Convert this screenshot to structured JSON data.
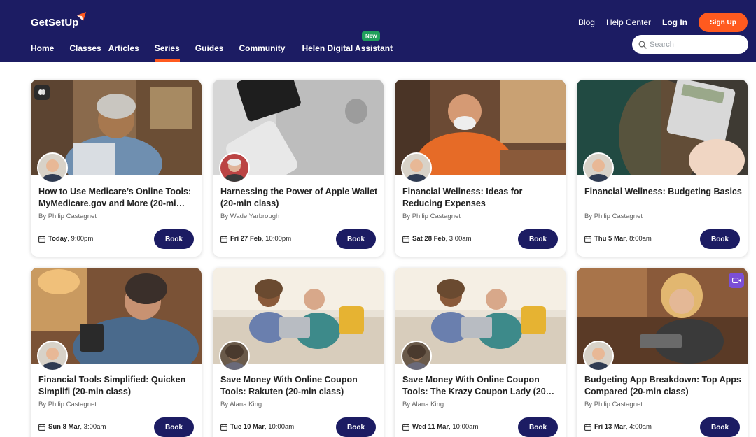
{
  "header": {
    "logo": "GetSetUp",
    "nav": [
      {
        "label": "Home"
      },
      {
        "label": "Classes"
      },
      {
        "label": "Articles"
      },
      {
        "label": "Series"
      },
      {
        "label": "Guides"
      },
      {
        "label": "Community"
      },
      {
        "label": "Helen Digital Assistant"
      }
    ],
    "active_nav": "Series",
    "new_badge": "New",
    "links": {
      "blog": "Blog",
      "help": "Help Center",
      "login": "Log In",
      "signup": "Sign Up"
    },
    "search_placeholder": "Search"
  },
  "colors": {
    "navy": "#1c1c63",
    "accent": "#ff5a1f",
    "new_badge": "#1f9f5b",
    "video_badge": "#7b4fd6"
  },
  "cards": [
    {
      "title": "How to Use Medicare’s Online Tools: MyMedicare.gov and More (20-mi…",
      "author": "By Philip Castagnet",
      "date_day": "Today",
      "date_time": ", 9:00pm",
      "book": "Book",
      "badge_icon": "brain-icon"
    },
    {
      "title": "Harnessing the Power of Apple Wallet (20-min class)",
      "author": "By Wade Yarbrough",
      "date_day": "Fri 27 Feb",
      "date_time": ", 10:00pm",
      "book": "Book"
    },
    {
      "title": "Financial Wellness: Ideas for Reducing Expenses",
      "author": "By Philip Castagnet",
      "date_day": "Sat 28 Feb",
      "date_time": ", 3:00am",
      "book": "Book"
    },
    {
      "title": "Financial Wellness: Budgeting Basics",
      "author": "By Philip Castagnet",
      "date_day": "Thu 5 Mar",
      "date_time": ", 8:00am",
      "book": "Book"
    },
    {
      "title": "Financial Tools Simplified: Quicken Simplifi (20-min class)",
      "author": "By Philip Castagnet",
      "date_day": "Sun 8 Mar",
      "date_time": ", 3:00am",
      "book": "Book"
    },
    {
      "title": "Save Money With Online Coupon Tools: Rakuten (20-min class)",
      "author": "By Alana King",
      "date_day": "Tue 10 Mar",
      "date_time": ", 10:00am",
      "book": "Book"
    },
    {
      "title": "Save Money With Online Coupon Tools: The Krazy Coupon Lady (20…",
      "author": "By Alana King",
      "date_day": "Wed 11 Mar",
      "date_time": ", 10:00am",
      "book": "Book"
    },
    {
      "title": "Budgeting App Breakdown: Top Apps Compared (20-min class)",
      "author": "By Philip Castagnet",
      "date_day": "Fri 13 Mar",
      "date_time": ", 4:00am",
      "book": "Book",
      "badge_icon": "video-icon"
    }
  ]
}
